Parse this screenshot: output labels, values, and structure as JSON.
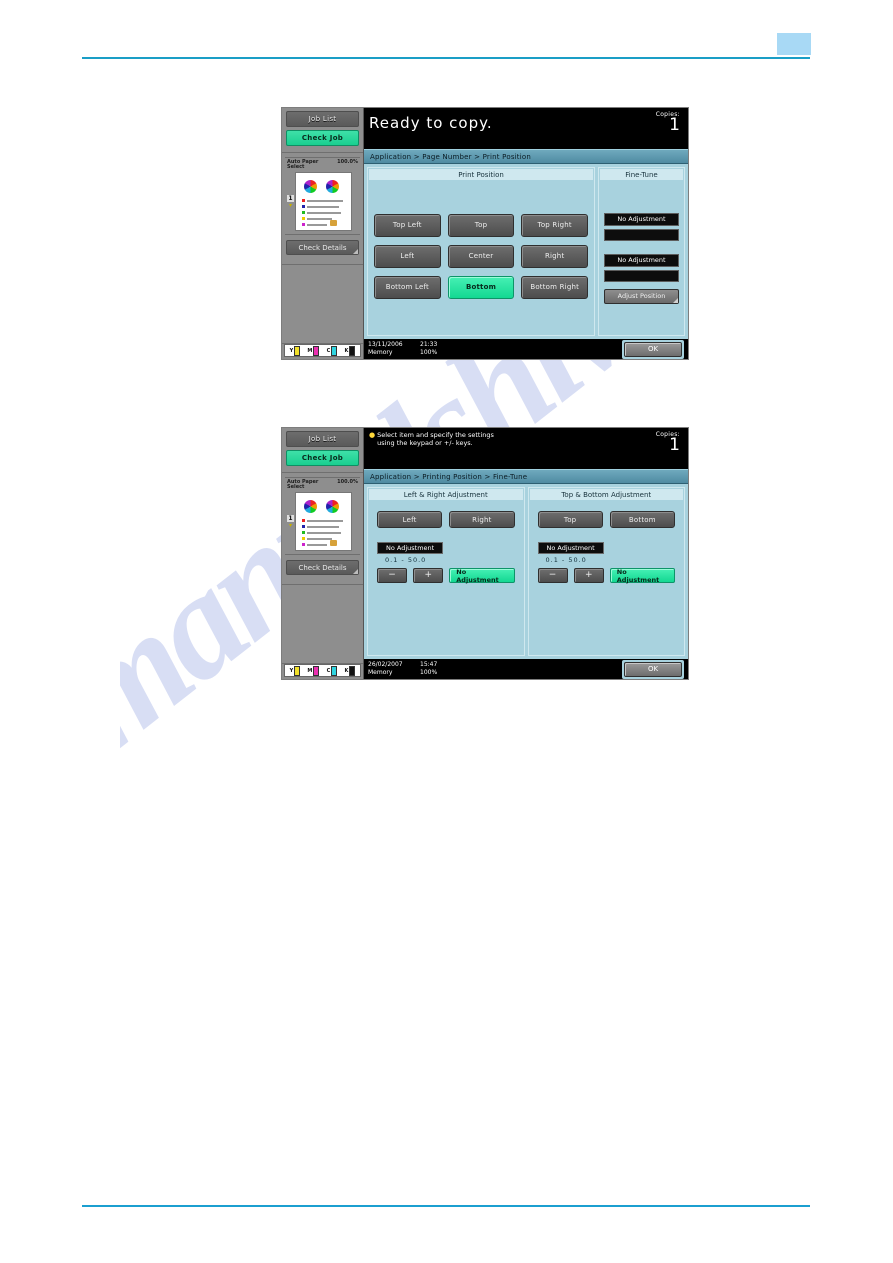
{
  "page": {
    "watermark": "manualshive.com",
    "page_number_box": "",
    "accent_rule_color": "#1a9ec6"
  },
  "screens": [
    {
      "id": "print-position",
      "message": "Ready to copy.",
      "copies_label": "Copies:",
      "copies_value": "1",
      "breadcrumb": "Application > Page Number > Print Position",
      "operator": {
        "job_list": "Job List",
        "check_job": "Check Job",
        "paper_label": "Auto Paper\nSelect",
        "paper_zoom": "100.0%",
        "tray_number": "1",
        "check_details": "Check Details",
        "toner": [
          "Y",
          "M",
          "C",
          "K"
        ]
      },
      "section_title": "Print Position",
      "fine_tune_title": "Fine-Tune",
      "position_buttons": [
        [
          "Top Left",
          "Top",
          "Top Right"
        ],
        [
          "Left",
          "Center",
          "Right"
        ],
        [
          "Bottom Left",
          "Bottom",
          "Bottom Right"
        ]
      ],
      "selected_position": "Bottom",
      "fine_tune": {
        "value_1": "No Adjustment",
        "field_1": "",
        "value_2": "No Adjustment",
        "field_2": "",
        "adjust_position": "Adjust Position"
      },
      "status": {
        "date": "13/11/2006",
        "time": "21:33",
        "memory_label": "Memory",
        "memory_value": "100%",
        "ok": "OK"
      }
    },
    {
      "id": "fine-tune",
      "message_line1": "Select item and specify the settings",
      "message_line2": "using the keypad or +/- keys.",
      "copies_label": "Copies:",
      "copies_value": "1",
      "breadcrumb": "Application > Printing Position > Fine-Tune",
      "operator": {
        "job_list": "Job List",
        "check_job": "Check Job",
        "paper_label": "Auto Paper\nSelect",
        "paper_zoom": "100.0%",
        "tray_number": "1",
        "check_details": "Check Details",
        "toner": [
          "Y",
          "M",
          "C",
          "K"
        ]
      },
      "left_section": {
        "title": "Left & Right Adjustment",
        "button_a": "Left",
        "button_b": "Right",
        "value": "No Adjustment",
        "range": "0.1  -  50.0",
        "minus": "−",
        "plus": "+",
        "no_adjustment": "No Adjustment"
      },
      "right_section": {
        "title": "Top & Bottom Adjustment",
        "button_a": "Top",
        "button_b": "Bottom",
        "value": "No Adjustment",
        "range": "0.1  -  50.0",
        "minus": "−",
        "plus": "+",
        "no_adjustment": "No Adjustment"
      },
      "status": {
        "date": "26/02/2007",
        "time": "15:47",
        "memory_label": "Memory",
        "memory_value": "100%",
        "ok": "OK"
      }
    }
  ]
}
